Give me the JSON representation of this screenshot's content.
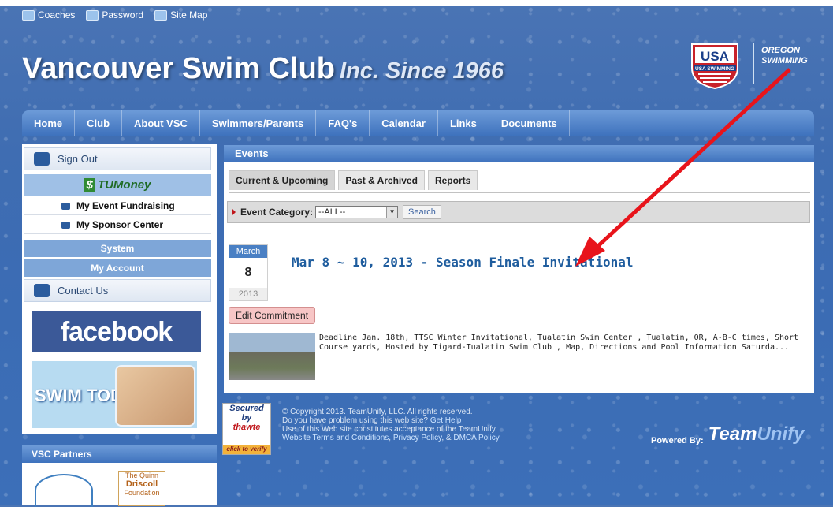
{
  "top_links": [
    "Coaches",
    "Password",
    "Site Map"
  ],
  "header": {
    "title": "Vancouver Swim Club",
    "since": "Inc. Since 1966",
    "usa_logo_text": "USA SWIMMING",
    "oregon_line1": "OREGON",
    "oregon_line2": "SWIMMING"
  },
  "nav": [
    "Home",
    "Club",
    "About VSC",
    "Swimmers/Parents",
    "FAQ's",
    "Calendar",
    "Links",
    "Documents"
  ],
  "sidebar": {
    "sign_out": "Sign Out",
    "tumoney": "TUMoney",
    "tumoney_s": "$",
    "my_event_fundraising": "My Event Fundraising",
    "my_sponsor_center": "My Sponsor Center",
    "system": "System",
    "my_account": "My Account",
    "contact_us": "Contact Us",
    "facebook": "facebook",
    "swim_today": "SWIM TODAY"
  },
  "partners": {
    "header": "VSC Partners",
    "logo2_line1": "The Quinn",
    "logo2_line2": "Driscoll",
    "logo2_line3": "Foundation"
  },
  "events": {
    "header": "Events",
    "tabs": [
      "Current & Upcoming",
      "Past & Archived",
      "Reports"
    ],
    "category_label": "Event Category:",
    "category_value": "--ALL--",
    "search_label": "Search",
    "cal_month": "March",
    "cal_day": "8",
    "cal_year": "2013",
    "event_title": "Mar 8 ~ 10, 2013 - Season Finale Invitational",
    "edit_label": "Edit Commitment",
    "description": "Deadline Jan. 18th, TTSC Winter Invitational, Tualatin Swim Center , Tualatin, OR, A-B-C times, Short Course yards, Hosted by Tigard-Tualatin Swim Club , Map, Directions and Pool Information Saturda..."
  },
  "footer": {
    "secured_line1": "Secured",
    "secured_line2": "by",
    "secured_line3": "thawte",
    "secured_verify": "click to verify",
    "copyright": "© Copyright 2013. TeamUnify, LLC. All rights reserved.",
    "problem": "Do you have problem using this web site?",
    "get_help": "Get Help",
    "acceptance": "Use of this Web site constitutes acceptance of the TeamUnify",
    "terms": "Website Terms and Conditions",
    "privacy": "Privacy Policy",
    "and": ", &",
    "dmca": "DMCA Policy",
    "powered_by": "Powered By:",
    "team": "Team",
    "unify": "Unify"
  },
  "colors": {
    "annotation_arrow": "#e8141b",
    "accent": "#3e72bd",
    "event_link": "#1f5d9e"
  }
}
